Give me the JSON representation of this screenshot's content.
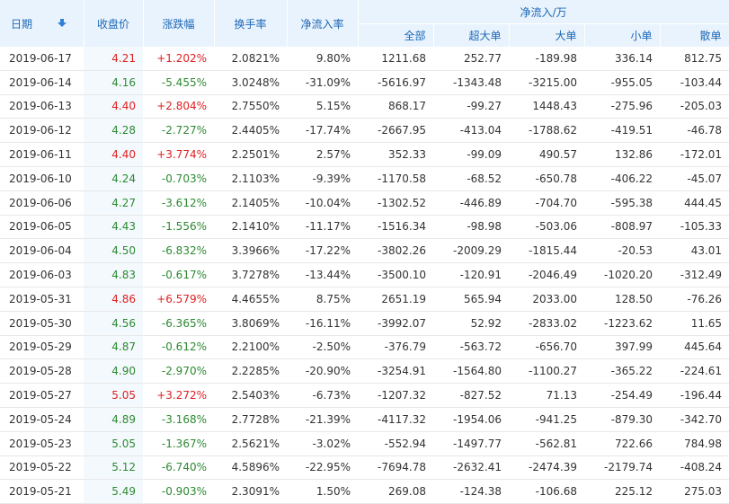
{
  "headers": {
    "date": "日期",
    "close": "收盘价",
    "change": "涨跌幅",
    "turnover": "换手率",
    "net_ratio": "净流入率",
    "net_flow_group": "净流入/万",
    "all": "全部",
    "super_large": "超大单",
    "large": "大单",
    "small": "小单",
    "retail": "散单"
  },
  "icons": {
    "sort": "sort-down-arrow-icon"
  },
  "colors": {
    "up": "#e02020",
    "down": "#2c8a31",
    "header_text": "#1c67b6",
    "header_bg": "#e9f3fd"
  },
  "rows": [
    {
      "date": "2019-06-17",
      "close": "4.21",
      "change": "+1.202%",
      "turnover": "2.0821%",
      "net_ratio": "9.80%",
      "all": "1211.68",
      "super_large": "252.77",
      "large": "-189.98",
      "small": "336.14",
      "retail": "812.75",
      "dir": "up"
    },
    {
      "date": "2019-06-14",
      "close": "4.16",
      "change": "-5.455%",
      "turnover": "3.0248%",
      "net_ratio": "-31.09%",
      "all": "-5616.97",
      "super_large": "-1343.48",
      "large": "-3215.00",
      "small": "-955.05",
      "retail": "-103.44",
      "dir": "down"
    },
    {
      "date": "2019-06-13",
      "close": "4.40",
      "change": "+2.804%",
      "turnover": "2.7550%",
      "net_ratio": "5.15%",
      "all": "868.17",
      "super_large": "-99.27",
      "large": "1448.43",
      "small": "-275.96",
      "retail": "-205.03",
      "dir": "up"
    },
    {
      "date": "2019-06-12",
      "close": "4.28",
      "change": "-2.727%",
      "turnover": "2.4405%",
      "net_ratio": "-17.74%",
      "all": "-2667.95",
      "super_large": "-413.04",
      "large": "-1788.62",
      "small": "-419.51",
      "retail": "-46.78",
      "dir": "down"
    },
    {
      "date": "2019-06-11",
      "close": "4.40",
      "change": "+3.774%",
      "turnover": "2.2501%",
      "net_ratio": "2.57%",
      "all": "352.33",
      "super_large": "-99.09",
      "large": "490.57",
      "small": "132.86",
      "retail": "-172.01",
      "dir": "up"
    },
    {
      "date": "2019-06-10",
      "close": "4.24",
      "change": "-0.703%",
      "turnover": "2.1103%",
      "net_ratio": "-9.39%",
      "all": "-1170.58",
      "super_large": "-68.52",
      "large": "-650.78",
      "small": "-406.22",
      "retail": "-45.07",
      "dir": "down"
    },
    {
      "date": "2019-06-06",
      "close": "4.27",
      "change": "-3.612%",
      "turnover": "2.1405%",
      "net_ratio": "-10.04%",
      "all": "-1302.52",
      "super_large": "-446.89",
      "large": "-704.70",
      "small": "-595.38",
      "retail": "444.45",
      "dir": "down"
    },
    {
      "date": "2019-06-05",
      "close": "4.43",
      "change": "-1.556%",
      "turnover": "2.1410%",
      "net_ratio": "-11.17%",
      "all": "-1516.34",
      "super_large": "-98.98",
      "large": "-503.06",
      "small": "-808.97",
      "retail": "-105.33",
      "dir": "down"
    },
    {
      "date": "2019-06-04",
      "close": "4.50",
      "change": "-6.832%",
      "turnover": "3.3966%",
      "net_ratio": "-17.22%",
      "all": "-3802.26",
      "super_large": "-2009.29",
      "large": "-1815.44",
      "small": "-20.53",
      "retail": "43.01",
      "dir": "down"
    },
    {
      "date": "2019-06-03",
      "close": "4.83",
      "change": "-0.617%",
      "turnover": "3.7278%",
      "net_ratio": "-13.44%",
      "all": "-3500.10",
      "super_large": "-120.91",
      "large": "-2046.49",
      "small": "-1020.20",
      "retail": "-312.49",
      "dir": "down"
    },
    {
      "date": "2019-05-31",
      "close": "4.86",
      "change": "+6.579%",
      "turnover": "4.4655%",
      "net_ratio": "8.75%",
      "all": "2651.19",
      "super_large": "565.94",
      "large": "2033.00",
      "small": "128.50",
      "retail": "-76.26",
      "dir": "up"
    },
    {
      "date": "2019-05-30",
      "close": "4.56",
      "change": "-6.365%",
      "turnover": "3.8069%",
      "net_ratio": "-16.11%",
      "all": "-3992.07",
      "super_large": "52.92",
      "large": "-2833.02",
      "small": "-1223.62",
      "retail": "11.65",
      "dir": "down"
    },
    {
      "date": "2019-05-29",
      "close": "4.87",
      "change": "-0.612%",
      "turnover": "2.2100%",
      "net_ratio": "-2.50%",
      "all": "-376.79",
      "super_large": "-563.72",
      "large": "-656.70",
      "small": "397.99",
      "retail": "445.64",
      "dir": "down"
    },
    {
      "date": "2019-05-28",
      "close": "4.90",
      "change": "-2.970%",
      "turnover": "2.2285%",
      "net_ratio": "-20.90%",
      "all": "-3254.91",
      "super_large": "-1564.80",
      "large": "-1100.27",
      "small": "-365.22",
      "retail": "-224.61",
      "dir": "down"
    },
    {
      "date": "2019-05-27",
      "close": "5.05",
      "change": "+3.272%",
      "turnover": "2.5403%",
      "net_ratio": "-6.73%",
      "all": "-1207.32",
      "super_large": "-827.52",
      "large": "71.13",
      "small": "-254.49",
      "retail": "-196.44",
      "dir": "up"
    },
    {
      "date": "2019-05-24",
      "close": "4.89",
      "change": "-3.168%",
      "turnover": "2.7728%",
      "net_ratio": "-21.39%",
      "all": "-4117.32",
      "super_large": "-1954.06",
      "large": "-941.25",
      "small": "-879.30",
      "retail": "-342.70",
      "dir": "down"
    },
    {
      "date": "2019-05-23",
      "close": "5.05",
      "change": "-1.367%",
      "turnover": "2.5621%",
      "net_ratio": "-3.02%",
      "all": "-552.94",
      "super_large": "-1497.77",
      "large": "-562.81",
      "small": "722.66",
      "retail": "784.98",
      "dir": "down"
    },
    {
      "date": "2019-05-22",
      "close": "5.12",
      "change": "-6.740%",
      "turnover": "4.5896%",
      "net_ratio": "-22.95%",
      "all": "-7694.78",
      "super_large": "-2632.41",
      "large": "-2474.39",
      "small": "-2179.74",
      "retail": "-408.24",
      "dir": "down"
    },
    {
      "date": "2019-05-21",
      "close": "5.49",
      "change": "-0.903%",
      "turnover": "2.3091%",
      "net_ratio": "1.50%",
      "all": "269.08",
      "super_large": "-124.38",
      "large": "-106.68",
      "small": "225.12",
      "retail": "275.03",
      "dir": "down"
    }
  ]
}
